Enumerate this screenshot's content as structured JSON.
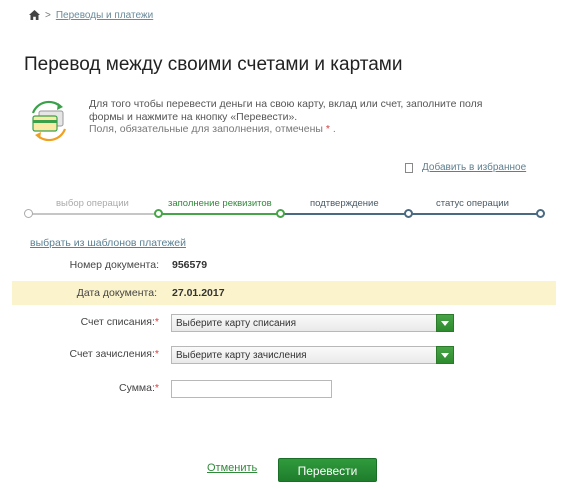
{
  "breadcrumb": {
    "link": "Переводы и платежи"
  },
  "title": "Перевод между своими счетами и картами",
  "info": {
    "line1": "Для того чтобы перевести деньги на свою карту, вклад или счет, заполните поля",
    "line2": "формы и нажмите на кнопку «Перевести».",
    "line3": "Поля, обязательные для заполнения, отмечены",
    "required_mark": "*",
    "line3_end": "."
  },
  "favorites_link": "Добавить в избранное",
  "steps": [
    {
      "label": "выбор операции",
      "state": "done"
    },
    {
      "label": "заполнение реквизитов",
      "state": "active"
    },
    {
      "label": "подтверждение",
      "state": "pending"
    },
    {
      "label": "статус операции",
      "state": "pending"
    }
  ],
  "templates_link": "выбрать из шаблонов платежей",
  "form": {
    "doc_number_label": "Номер документа:",
    "doc_number": "956579",
    "doc_date_label": "Дата документа:",
    "doc_date": "27.01.2017",
    "from_label": "Счет списания:",
    "from_placeholder": "Выберите карту списания",
    "to_label": "Счет зачисления:",
    "to_placeholder": "Выберите карту зачисления",
    "sum_label": "Сумма:",
    "required_mark": "*",
    "sum_value": ""
  },
  "buttons": {
    "cancel": "Отменить",
    "submit": "Перевести"
  },
  "colors": {
    "accent_green": "#2f9a3c",
    "step_done": "#bbbbbb",
    "step_active": "#46a546",
    "step_pending": "#4a6a82",
    "highlight_row": "#fbf3cc",
    "required": "#d04040"
  }
}
